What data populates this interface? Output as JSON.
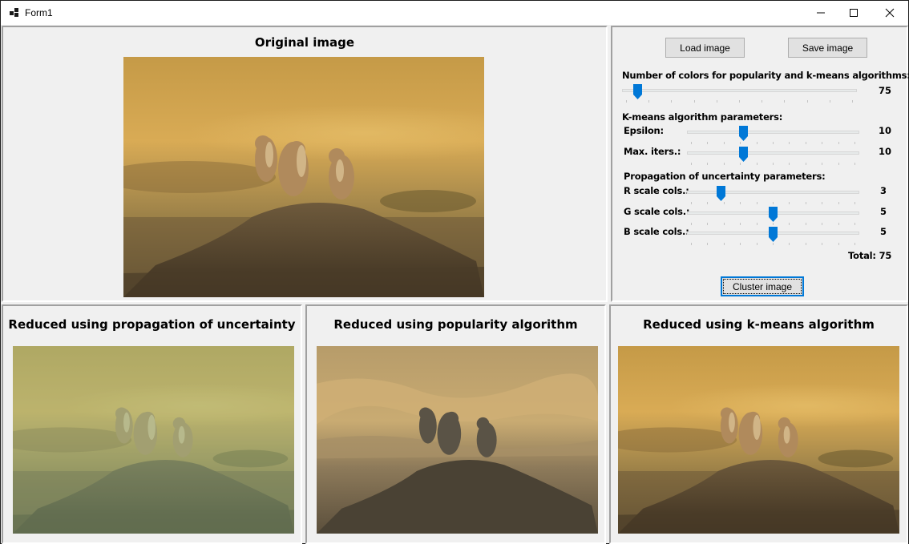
{
  "window": {
    "title": "Form1"
  },
  "original": {
    "title": "Original image"
  },
  "controls": {
    "load_label": "Load image",
    "save_label": "Save image",
    "num_colors_label": "Number of colors for popularity and k-means algorithms:",
    "num_colors_value": "75",
    "kmeans_header": "K-means algorithm parameters:",
    "epsilon_label": "Epsilon:",
    "epsilon_value": "10",
    "max_iters_label": "Max. iters.:",
    "max_iters_value": "10",
    "propagation_header": "Propagation of uncertainty parameters:",
    "r_label": "R scale cols.:",
    "r_value": "3",
    "g_label": "G scale cols.:",
    "g_value": "5",
    "b_label": "B scale cols.:",
    "b_value": "5",
    "total_label": "Total: 75",
    "cluster_label": "Cluster image",
    "slider_levels": {
      "num_colors": 0.05,
      "epsilon": 0.32,
      "max_iters": 0.32,
      "r": 0.18,
      "g": 0.5,
      "b": 0.5
    }
  },
  "results": [
    {
      "title": "Reduced using propagation of uncertainty"
    },
    {
      "title": "Reduced using popularity algorithm"
    },
    {
      "title": "Reduced using k-means algorithm"
    }
  ],
  "colors": {
    "accent": "#0078d7",
    "panel": "#f0f0f0",
    "slider_thumb": "#0078d7"
  },
  "icons": [
    "app-icon",
    "minimize-icon",
    "maximize-icon",
    "close-icon"
  ]
}
